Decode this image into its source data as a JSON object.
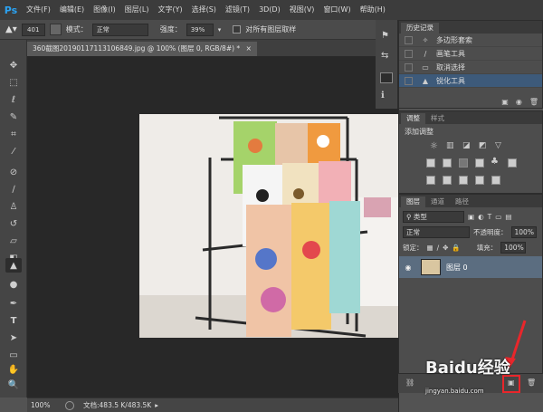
{
  "app": {
    "logo": "Ps"
  },
  "menu": [
    "文件(F)",
    "编辑(E)",
    "图像(I)",
    "图层(L)",
    "文字(Y)",
    "选择(S)",
    "滤镜(T)",
    "3D(D)",
    "视图(V)",
    "窗口(W)",
    "帮助(H)"
  ],
  "options": {
    "brush_size": "401",
    "mode_label": "模式：",
    "mode_value": "正常",
    "strength_label": "强度：",
    "strength_value": "39%",
    "sample_all_label": "对所有图层取样"
  },
  "document": {
    "tab_title": "360截图20190117113106849.jpg @ 100% (图层 0, RGB/8#) *"
  },
  "history": {
    "tab": "历史记录",
    "items": [
      {
        "label": "多边形套索",
        "icon": "polygon-lasso-icon"
      },
      {
        "label": "画笔工具",
        "icon": "brush-icon"
      },
      {
        "label": "取消选择",
        "icon": "deselect-icon"
      },
      {
        "label": "锐化工具",
        "icon": "sharpen-icon",
        "selected": true
      }
    ]
  },
  "adjustments": {
    "tabs": [
      "调整",
      "样式"
    ],
    "heading": "添加调整"
  },
  "layers": {
    "tabs": [
      "图层",
      "通道",
      "路径"
    ],
    "filter_label": "类型",
    "blend_mode": "正常",
    "opacity_label": "不透明度：",
    "opacity_value": "100%",
    "lock_label": "锁定：",
    "fill_label": "填充：",
    "fill_value": "100%",
    "layer_name": "图层 0"
  },
  "status": {
    "zoom": "100%",
    "doc_info": "文档:483.5 K/483.5K"
  },
  "watermark": {
    "brand": "Baidu经验",
    "url": "jingyan.baidu.com"
  },
  "colors": {
    "accent": "#2ba3f3",
    "highlight_arrow": "#e8262b",
    "selection": "#3d5a7a"
  }
}
